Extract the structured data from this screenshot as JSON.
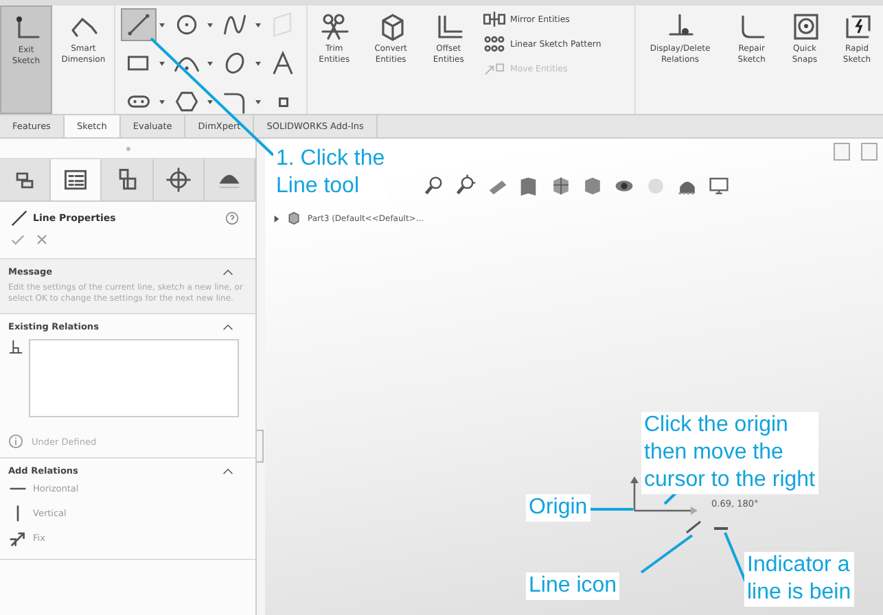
{
  "ribbon": {
    "large_buttons_left": [
      {
        "label": "Exit Sketch",
        "kind": "exit",
        "selected": true
      },
      {
        "label": "Smart Dimension",
        "kind": "dimension",
        "selected": false
      }
    ],
    "sketch_tools": [
      {
        "kind": "line",
        "selected": true,
        "disabled": false
      },
      {
        "kind": "circle",
        "selected": false,
        "disabled": false
      },
      {
        "kind": "spline",
        "selected": false,
        "disabled": false
      },
      {
        "kind": "plane",
        "selected": false,
        "disabled": true
      },
      {
        "kind": "rectangle",
        "selected": false,
        "disabled": false
      },
      {
        "kind": "arc",
        "selected": false,
        "disabled": false
      },
      {
        "kind": "ellipse",
        "selected": false,
        "disabled": false
      },
      {
        "kind": "text",
        "selected": false,
        "disabled": false
      },
      {
        "kind": "slot",
        "selected": false,
        "disabled": false
      },
      {
        "kind": "polygon",
        "selected": false,
        "disabled": false
      },
      {
        "kind": "fillet",
        "selected": false,
        "disabled": false
      },
      {
        "kind": "point",
        "selected": false,
        "disabled": false
      }
    ],
    "large_buttons_mid": [
      {
        "label": "Trim Entities",
        "kind": "trim"
      },
      {
        "label": "Convert Entities",
        "kind": "convert"
      },
      {
        "label": "Offset Entities",
        "kind": "offset"
      }
    ],
    "small_buttons": [
      {
        "label": "Mirror Entities",
        "kind": "mirror",
        "disabled": false
      },
      {
        "label": "Linear Sketch Pattern",
        "kind": "pattern",
        "disabled": false
      },
      {
        "label": "Move Entities",
        "kind": "move",
        "disabled": true
      }
    ],
    "large_buttons_right": [
      {
        "label": "Display/Delete Relations",
        "kind": "relations"
      },
      {
        "label": "Repair Sketch",
        "kind": "repair"
      },
      {
        "label": "Quick Snaps",
        "kind": "snaps"
      },
      {
        "label": "Rapid Sketch",
        "kind": "rapid"
      }
    ]
  },
  "tabs": [
    {
      "label": "Features",
      "selected": false
    },
    {
      "label": "Sketch",
      "selected": true
    },
    {
      "label": "Evaluate",
      "selected": false
    },
    {
      "label": "DimXpert",
      "selected": false
    },
    {
      "label": "SOLIDWORKS Add-Ins",
      "selected": false
    }
  ],
  "panel": {
    "tabs": [
      {
        "kind": "feature-tree",
        "selected": false
      },
      {
        "kind": "property",
        "selected": true
      },
      {
        "kind": "configuration",
        "selected": false
      },
      {
        "kind": "target",
        "selected": false
      },
      {
        "kind": "appearance",
        "selected": false
      }
    ],
    "title": "Line Properties",
    "message": {
      "title": "Message",
      "text": "Edit the settings of the current line, sketch a new line, or select OK to change the settings for the next new line."
    },
    "existing_relations": {
      "title": "Existing Relations"
    },
    "status": "Under Defined",
    "add_relations": {
      "title": "Add Relations",
      "items": [
        {
          "label": "Horizontal",
          "kind": "horizontal"
        },
        {
          "label": "Vertical",
          "kind": "vertical"
        },
        {
          "label": "Fix",
          "kind": "fix"
        }
      ]
    }
  },
  "graphics": {
    "tree_item": "Part3 (Default<<Default>...",
    "readout": "0.69, 180°"
  },
  "callouts": [
    {
      "kind": "step",
      "lines": [
        "1. Click the",
        "Line tool"
      ]
    },
    {
      "kind": "origin-note",
      "lines": [
        "Click the origin",
        "then move the",
        "cursor to the right"
      ]
    },
    {
      "kind": "origin",
      "lines": [
        "Origin"
      ]
    },
    {
      "kind": "line-icon",
      "lines": [
        "Line icon"
      ]
    },
    {
      "kind": "indicator",
      "lines": [
        "Indicator a",
        "line is bein"
      ]
    }
  ]
}
